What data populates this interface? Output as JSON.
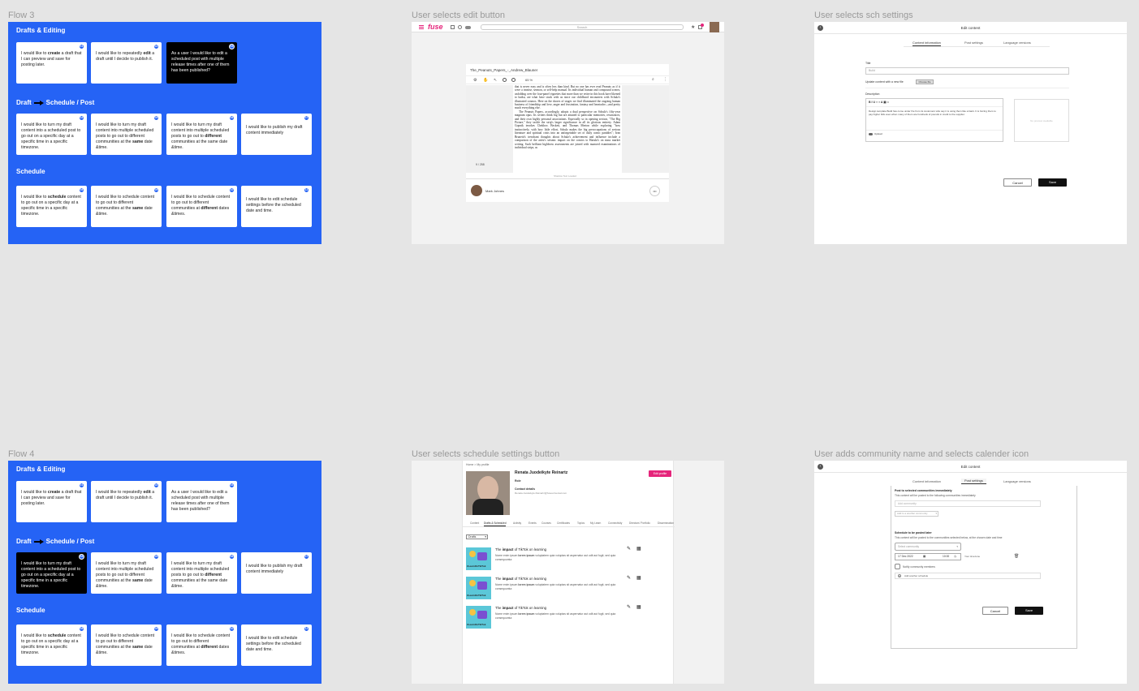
{
  "labels": {
    "flow3": "Flow 3",
    "edit_button": "User selects edit button",
    "sch_settings": "User selects sch settings",
    "flow4": "Flow 4",
    "schedule_button": "User selects schedule settings button",
    "community_calendar": "User adds community name and selects calender icon"
  },
  "flow_board": {
    "section_drafts": "Drafts & Editing",
    "section_draft_a": "Draft",
    "section_draft_b": "Schedule / Post",
    "section_schedule": "Schedule",
    "drafts_cards": [
      {
        "badge": "01",
        "pre": "I would like to ",
        "b": "create",
        "post": " a draft that I can preview and save for posting later."
      },
      {
        "badge": "02",
        "pre": "I would like to repeatedly ",
        "b": "edit",
        "post": " a draft until I decide to publish it."
      },
      {
        "badge": "03",
        "pre": "As a user I would like to edit a scheduled post with multiple release times after one of them has been published?",
        "b": "",
        "post": ""
      }
    ],
    "draft_cards": [
      {
        "badge": "04",
        "pre": "I would like to turn my draft content into a scheduled post to go out on a specific day at a specific time in a specific timezone.",
        "b": "",
        "post": ""
      },
      {
        "badge": "05",
        "pre": "I would like to turn my draft content into multiple scheduled posts to go out to different communities at the ",
        "b": "same",
        "post": " date &time."
      },
      {
        "badge": "06",
        "pre": "I would like to turn my draft content into multiple scheduled posts to go out to ",
        "b": "different",
        "post": " communities at the same date &time."
      },
      {
        "badge": "07",
        "pre": "I would like to publish my draft content immediately",
        "b": "",
        "post": ""
      }
    ],
    "schedule_cards": [
      {
        "badge": "08",
        "pre": "I would like to ",
        "b": "schedule",
        "post": " content to go out on a specific day at a specific time in a specific timezone."
      },
      {
        "badge": "09",
        "pre": "I would like to schedule content to go out to different communities at the ",
        "b": "same",
        "post": " date &time."
      },
      {
        "badge": "10",
        "pre": "I would like to schedule content to go out to different communities at ",
        "b": "different",
        "post": " dates &times."
      },
      {
        "badge": "11",
        "pre": "I would like to edit schedule settings before the scheduled date and time.",
        "b": "",
        "post": ""
      }
    ],
    "draft_cards_f3_bold": [
      "",
      "",
      "different",
      ""
    ],
    "draft_cards_f3_bold_alt": [
      "",
      "same",
      "",
      ""
    ]
  },
  "edit_frame": {
    "logo": "fuse",
    "search": "Search",
    "doc_title": "The_Peanuts_Papers_-_Andrew_Blauner",
    "zoom": "65 %",
    "page_count": "9 / 258",
    "author": "Mark Johnes",
    "more": "•••",
    "body_text": "that is never easy and is often less than kind. But no one has ever read Peanuts as if it were a treatise, sermon, or self-help manual. Its individual human and compound scenes, unfolding over the four-panel vignettes that more than we retire in this book have likened to haiku, are what have stuck with us since our childhood encounters with Schulz's illustrated cosmos. Here on the shores of stages we find illuminated the ongoing human business of friendship and love, anger and frustration, fantasy and heartache—and pretty much everything else.",
    "body_text2": "The Peanuts Papers, accordingly, adopts a dual perspective on Schulz's fifty-year magnum opus. Its writers think big but are attuned to particular memories, resonances, and their own highly personal associations. Especially so in opening section, \"The Big Picture,\" they tackle the strip's larger significance in all its glorious entirety. Adam Gopnik invokes Chekhov, Beckett, and Thomas Merton while exploring \"how instinctively, with how little effort, Schulz makes the big preoccupations of serious literature and spiritual crisis into an unforgettable set of daily comic parables\"; Ivan Brunetti's trenchant thoughts about Schulz's achievement and influence include a comparison of the artist's seismic impact on the comics to Haruki's on mass market writing. Such brilliant highbrow assessments are joined with nuanced examinations of individual strips, as",
    "footer_note": "Shadow Text Loaded"
  },
  "edit_content_1": {
    "title": "Edit content",
    "tabs": [
      "Content information",
      "Post settings",
      "Language versions"
    ],
    "title_label": "Title",
    "title_value": "Build",
    "update_label": "Update content with a new file",
    "choose_file": "Choose file",
    "desc_label": "Description",
    "toolbar": "B  I  U  ≡  ≡  A  ▣  ∞",
    "desc_text": "Design template Build has come under fire from its customers who say it is using them like a bank. It is forcing them to pay higher bills even when many of them are hundreds of pounds in credit to the supplier.",
    "upload": "Upload",
    "img_placeholder": "No preview available",
    "cancel": "Cancel",
    "save": "Save"
  },
  "profile_frame": {
    "breadcrumb": "Home > My profile",
    "name": "Renata Juodeikyte Reinartz",
    "role": "Role",
    "contact_label": "Contact details",
    "contact_value": "Renata.Juodeikyte.Reinartz@fuseuniversal.com",
    "edit_profile": "Edit profile",
    "tabs": [
      "Content",
      "Drafts & Scheduled",
      "Activity",
      "Events",
      "Courses",
      "Certificates",
      "Topics",
      "My Learn",
      "Connectivity",
      "Directors' Portfolio",
      "Dissemination"
    ],
    "filter": "Drafts",
    "thumb_tag": "#LearnOnTikTok",
    "items": [
      {
        "title_pre": "The ",
        "title_b": "impact",
        "title_post": " of TikTok on learning",
        "desc_pre": "Nome enim ipsum ",
        "desc_b": "lorem ipsum",
        "desc_post": " voluptatem quia voluptas sit aspernatur aut odit aut fugit, sed quia consequuntur."
      },
      {
        "title_pre": "The ",
        "title_b": "impact",
        "title_post": " of TikTok on learning",
        "desc_pre": "Nome enim ipsum ",
        "desc_b": "lorem ipsum",
        "desc_post": " voluptatem quia voluptas sit aspernatur aut odit aut fugit, sed quia consequuntur."
      },
      {
        "title_pre": "The ",
        "title_b": "impact",
        "title_post": " of TikTok on learning",
        "desc_pre": "Nome enim ipsum ",
        "desc_b": "lorem ipsum",
        "desc_post": " voluptatem quia voluptas sit aspernatur aut odit aut fugit, sed quia consequuntur."
      }
    ]
  },
  "edit_content_2": {
    "title": "Edit content",
    "tabs": [
      "Content information",
      "Post settings",
      "Language versions"
    ],
    "post_label": "Post to selected communities immediately",
    "post_desc": "This content will be posted to the following communities immediately",
    "add_community": "Add community",
    "add_another": "Add to a another community",
    "schedule_label": "Schedule to be posted later",
    "schedule_desc": "This content will be posted to the communities selected below, at the chosen date and time",
    "select_community": "Select community",
    "date": "17 Dec 2022",
    "time": "10:00",
    "timezone": "Your timezone",
    "notify": "Notify community members",
    "add_schedule": "Add another schedule",
    "cancel": "Cancel",
    "save": "Save"
  },
  "colors": {
    "board_blue": "#2563f5",
    "fuse_pink": "#e5257b",
    "card_dark": "#000000"
  }
}
